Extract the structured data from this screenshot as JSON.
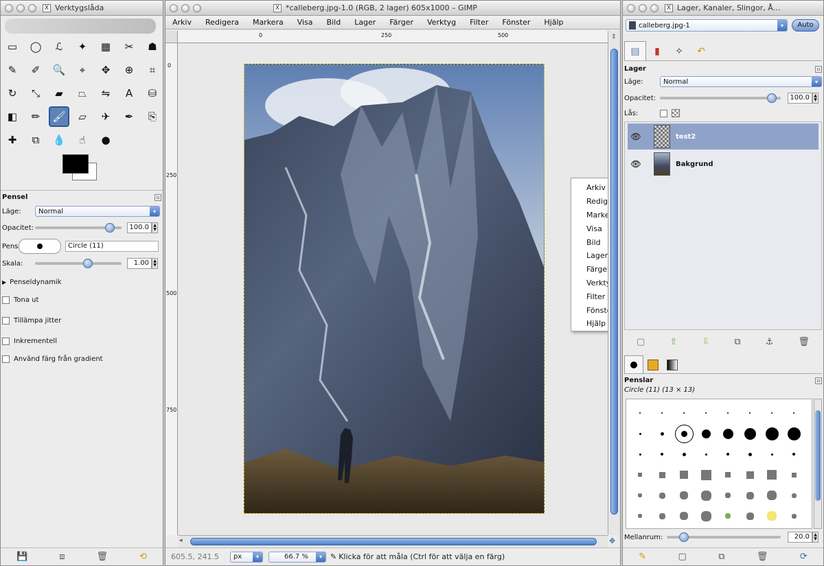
{
  "toolbox": {
    "title": "Verktygslåda",
    "tools": [
      {
        "name": "rect-select-icon",
        "glyph": "▭"
      },
      {
        "name": "ellipse-select-icon",
        "glyph": "◯"
      },
      {
        "name": "lasso-icon",
        "glyph": "ℒ"
      },
      {
        "name": "fuzzy-select-icon",
        "glyph": "✦"
      },
      {
        "name": "color-select-icon",
        "glyph": "▦"
      },
      {
        "name": "scissors-icon",
        "glyph": "✂"
      },
      {
        "name": "foreground-select-icon",
        "glyph": "☗"
      },
      {
        "name": "paths-icon",
        "glyph": "✎"
      },
      {
        "name": "color-picker-icon",
        "glyph": "✐"
      },
      {
        "name": "zoom-icon",
        "glyph": "🔍"
      },
      {
        "name": "measure-icon",
        "glyph": "⌖"
      },
      {
        "name": "move-icon",
        "glyph": "✥"
      },
      {
        "name": "align-icon",
        "glyph": "⊕"
      },
      {
        "name": "crop-icon",
        "glyph": "⌗"
      },
      {
        "name": "rotate-icon",
        "glyph": "↻"
      },
      {
        "name": "scale-icon",
        "glyph": "⤡"
      },
      {
        "name": "shear-icon",
        "glyph": "▰"
      },
      {
        "name": "perspective-icon",
        "glyph": "⏢"
      },
      {
        "name": "flip-icon",
        "glyph": "⇋"
      },
      {
        "name": "text-icon",
        "glyph": "A"
      },
      {
        "name": "bucket-fill-icon",
        "glyph": "⛁"
      },
      {
        "name": "blend-icon",
        "glyph": "◧"
      },
      {
        "name": "pencil-icon",
        "glyph": "✏"
      },
      {
        "name": "paintbrush-icon",
        "glyph": "🖌"
      },
      {
        "name": "eraser-icon",
        "glyph": "▱"
      },
      {
        "name": "airbrush-icon",
        "glyph": "✈"
      },
      {
        "name": "ink-icon",
        "glyph": "✒"
      },
      {
        "name": "clone-icon",
        "glyph": "⎘"
      },
      {
        "name": "heal-icon",
        "glyph": "✚"
      },
      {
        "name": "perspective-clone-icon",
        "glyph": "⧉"
      },
      {
        "name": "blur-icon",
        "glyph": "💧"
      },
      {
        "name": "smudge-icon",
        "glyph": "☝"
      },
      {
        "name": "dodge-burn-icon",
        "glyph": "●"
      }
    ],
    "options_title": "Pensel",
    "mode_label": "Läge:",
    "mode_value": "Normal",
    "opacity_label": "Opacitet:",
    "opacity_value": "100.0",
    "opacity_fraction": 1.0,
    "brush_label": "Pensel",
    "brush_value": "Circle (11)",
    "scale_label": "Skala:",
    "scale_value": "1.00",
    "dynamics_label": "Penseldynamik",
    "checkboxes": [
      "Tona ut",
      "Tillämpa jitter",
      "Inkrementell",
      "Använd färg från gradient"
    ]
  },
  "image_window": {
    "title": "*calleberg.jpg-1.0 (RGB, 2 lager) 605x1000 – GIMP",
    "menu": [
      "Arkiv",
      "Redigera",
      "Markera",
      "Visa",
      "Bild",
      "Lager",
      "Färger",
      "Verktyg",
      "Filter",
      "Fönster",
      "Hjälp"
    ],
    "ruler_h_ticks": [
      "0",
      "250",
      "500"
    ],
    "ruler_v_ticks": [
      "0",
      "250",
      "500",
      "750"
    ],
    "context_menu": [
      "Arkiv",
      "Redigera",
      "Markera",
      "Visa",
      "Bild",
      "Lager",
      "Färger",
      "Verktyg",
      "Filter",
      "Fönster",
      "Hjälp"
    ],
    "status": {
      "coords": "605.5, 241.5",
      "unit": "px",
      "zoom": "66.7 %",
      "message": "Klicka för att måla (Ctrl för att välja en färg)"
    }
  },
  "layers_window": {
    "title": "Lager, Kanaler, Slingor, Å...",
    "image_select": "calleberg.jpg-1",
    "auto_button": "Auto",
    "panel_title": "Lager",
    "mode_label": "Läge:",
    "mode_value": "Normal",
    "opacity_label": "Opacitet:",
    "opacity_value": "100.0",
    "lock_label": "Lås:",
    "layers": [
      {
        "name": "test2",
        "selected": true
      },
      {
        "name": "Bakgrund",
        "selected": false
      }
    ],
    "brushes_title": "Penslar",
    "brush_info": "Circle (11) (13 × 13)",
    "spacing_label": "Mellanrum:",
    "spacing_value": "20.0"
  }
}
